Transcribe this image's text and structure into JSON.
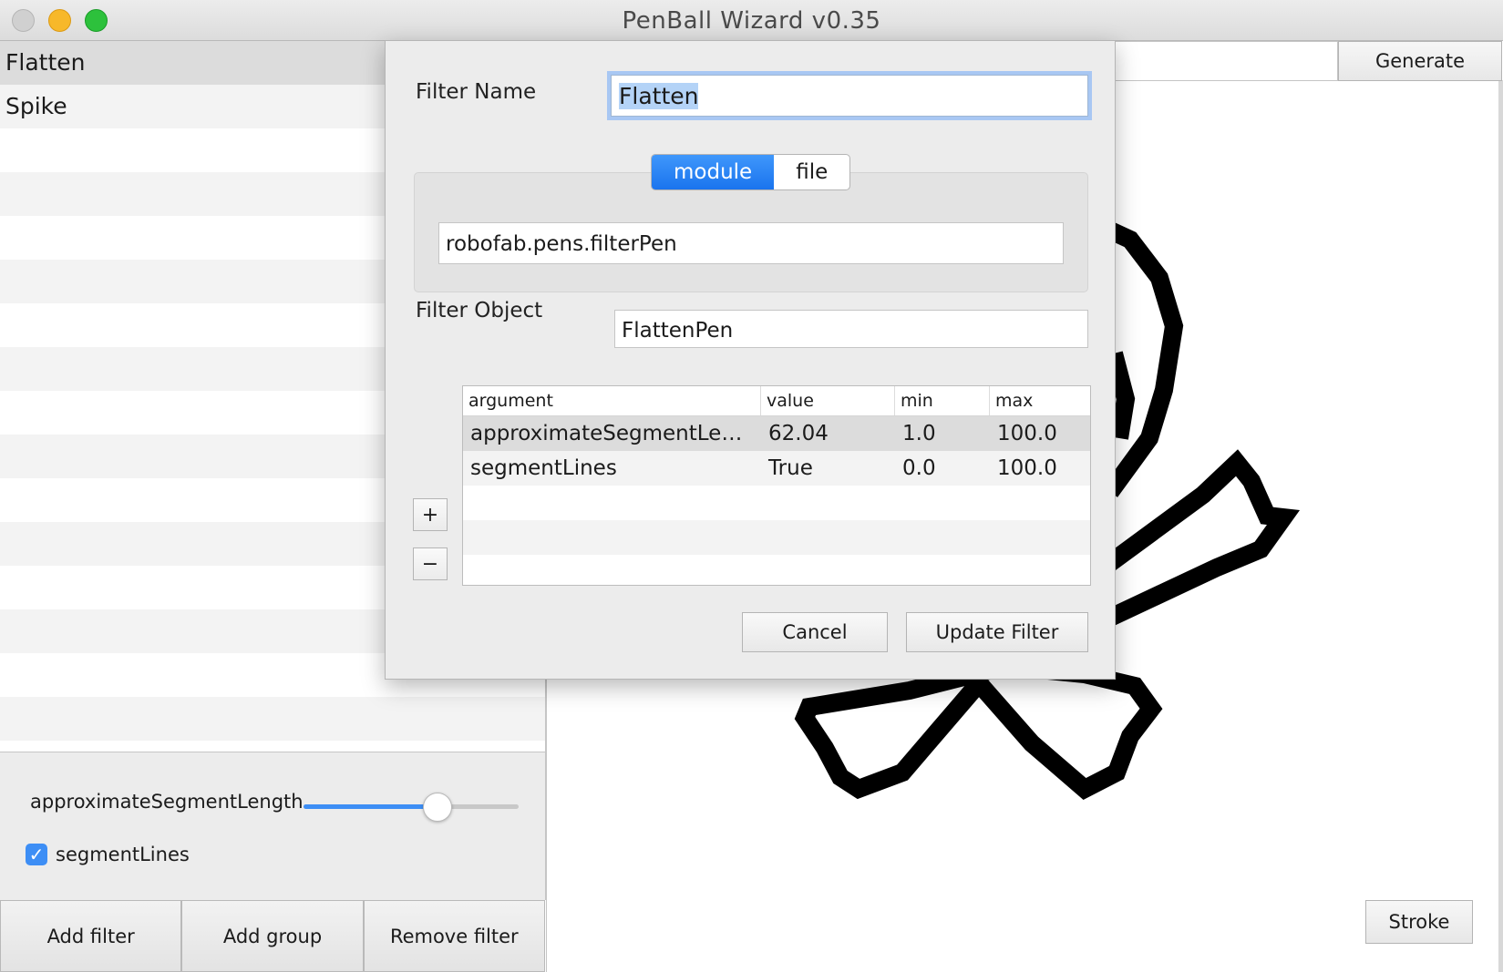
{
  "window": {
    "title": "PenBall Wizard v0.35"
  },
  "filters": {
    "items": [
      {
        "label": "Flatten",
        "selected": true
      },
      {
        "label": "Spike",
        "selected": false
      }
    ]
  },
  "controls": {
    "slider_label": "approximateSegmentLength",
    "slider_value": 62.04,
    "slider_min": 1.0,
    "slider_max": 100.0,
    "checkbox_label": "segmentLines",
    "checkbox_checked": true
  },
  "bottom_buttons": {
    "add_filter": "Add filter",
    "add_group": "Add group",
    "remove_filter": "Remove filter"
  },
  "toolbar": {
    "generate_label": "Generate",
    "text_value": ""
  },
  "preview": {
    "stroke_label": "Stroke",
    "glyph_icon": "skull-and-crossbones-icon"
  },
  "sheet": {
    "filter_name_label": "Filter Name",
    "filter_name_value": "Flatten",
    "source_tabs": [
      {
        "label": "module",
        "active": true
      },
      {
        "label": "file",
        "active": false
      }
    ],
    "module_path": "robofab.pens.filterPen",
    "filter_object_label": "Filter Object",
    "filter_object_value": "FlattenPen",
    "args_table": {
      "columns": [
        "argument",
        "value",
        "min",
        "max"
      ],
      "rows": [
        {
          "argument": "approximateSegmentLe…",
          "value": "62.04",
          "min": "1.0",
          "max": "100.0"
        },
        {
          "argument": "segmentLines",
          "value": "True",
          "min": "0.0",
          "max": "100.0"
        }
      ]
    },
    "add_arg": "+",
    "remove_arg": "−",
    "cancel_label": "Cancel",
    "update_label": "Update Filter"
  },
  "colors": {
    "accent": "#3d8ef5",
    "selection": "#dcdcdc"
  }
}
